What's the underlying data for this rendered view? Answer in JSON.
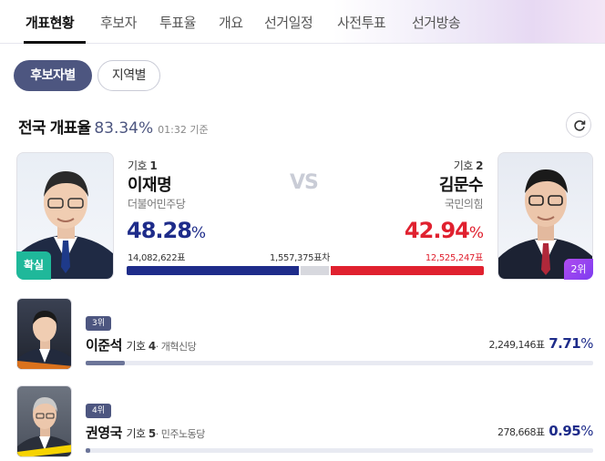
{
  "nav": {
    "tabs": [
      "개표현황",
      "후보자",
      "투표율",
      "개요",
      "선거일정",
      "사전투표",
      "선거방송"
    ],
    "active": 0
  },
  "view_toggle": {
    "by_candidate": "후보자별",
    "by_region": "지역별",
    "selected": "후보자별"
  },
  "count_header": {
    "title": "전국 개표율",
    "percent": "83.34",
    "percent_unit": "%",
    "time": "01:32 기준"
  },
  "main": {
    "vs": "VS",
    "margin": "1,557,375표차",
    "left": {
      "number_label": "기호",
      "number": "1",
      "name": "이재명",
      "party": "더불어민주당",
      "percent": "48.28",
      "unit": "%",
      "votes": "14,082,622표",
      "badge": "확실",
      "bar_fraction": 0.4828,
      "color": "#1e2c8a"
    },
    "right": {
      "number_label": "기호",
      "number": "2",
      "name": "김문수",
      "party": "국민의힘",
      "percent": "42.94",
      "unit": "%",
      "votes": "12,525,247표",
      "badge": "2위",
      "bar_fraction": 0.4294,
      "color": "#e0212f"
    }
  },
  "others": [
    {
      "rank": "3위",
      "name": "이준석",
      "number_label": "기호",
      "number": "4",
      "party": "개혁신당",
      "votes": "2,249,146표",
      "percent": "7.71",
      "unit": "%",
      "fraction": 0.0771
    },
    {
      "rank": "4위",
      "name": "권영국",
      "number_label": "기호",
      "number": "5",
      "party": "민주노동당",
      "votes": "278,668표",
      "percent": "0.95",
      "unit": "%",
      "fraction": 0.0095
    }
  ]
}
